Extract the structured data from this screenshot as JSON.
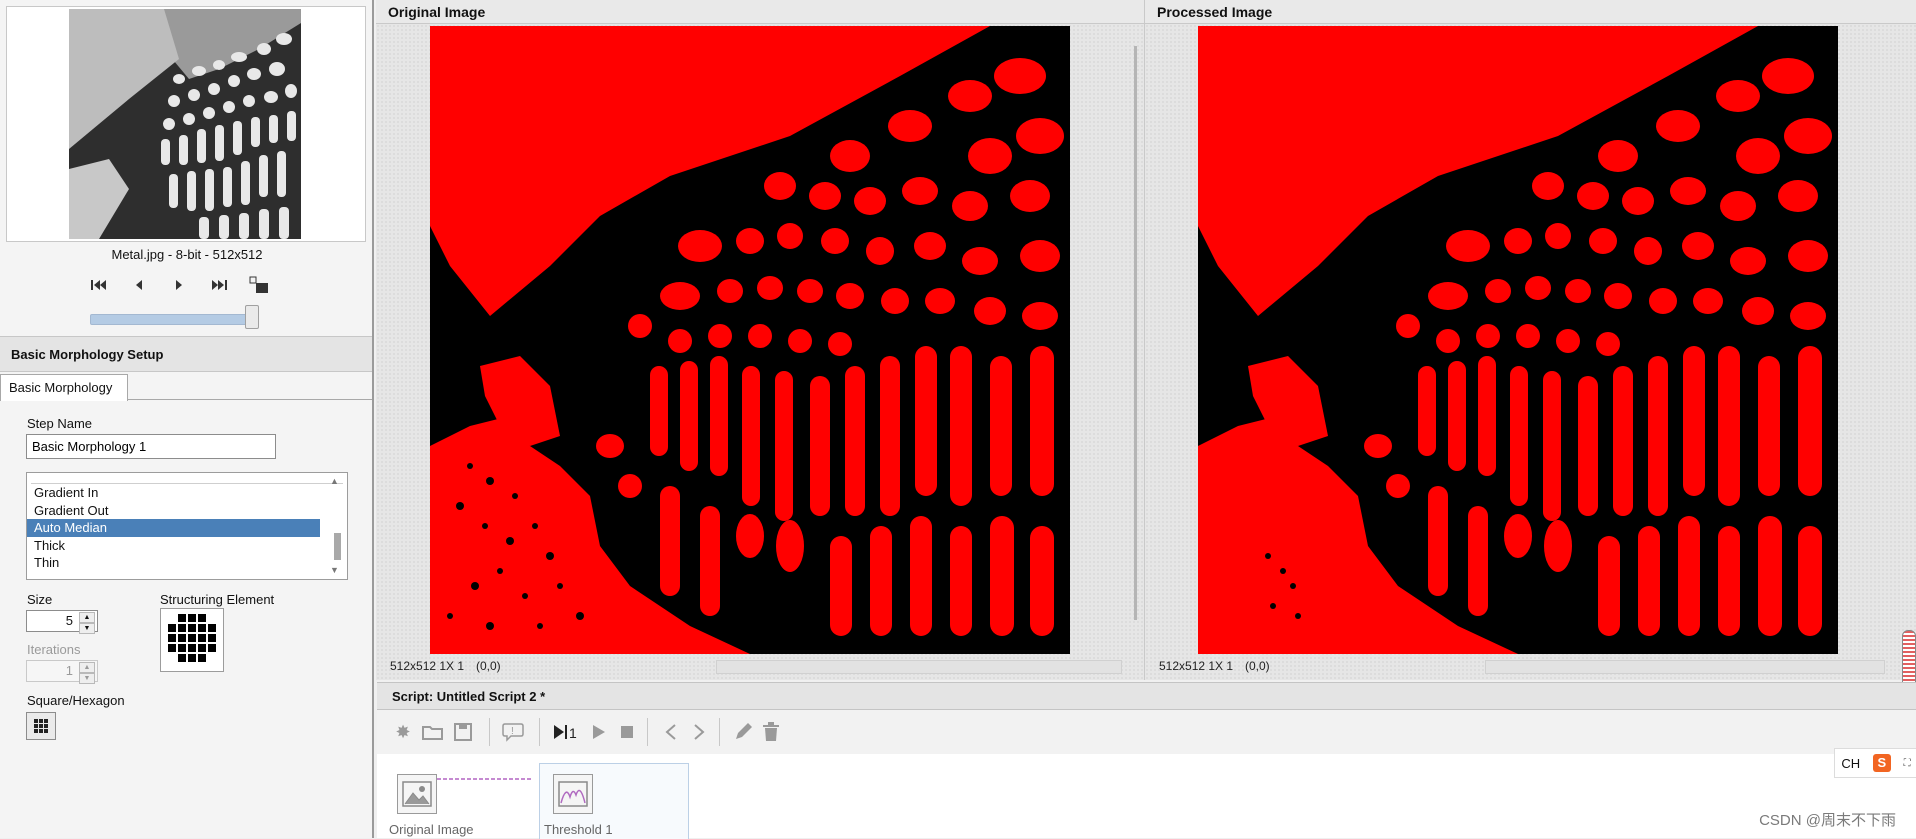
{
  "thumbnail": {
    "caption": "Metal.jpg - 8-bit - 512x512"
  },
  "setup": {
    "title": "Basic Morphology Setup",
    "tab_label": "Basic Morphology",
    "step_name_label": "Step Name",
    "step_name_value": "Basic Morphology 1",
    "operations": [
      "Gradient In",
      "Gradient Out",
      "Auto Median",
      "Thick",
      "Thin"
    ],
    "selected_operation": "Auto Median",
    "size_label": "Size",
    "size_value": "5",
    "iterations_label": "Iterations",
    "iterations_value": "1",
    "struct_label": "Structuring Element",
    "shape_label": "Square/Hexagon"
  },
  "original_view": {
    "title": "Original Image",
    "status_size": "512x512 1X 1",
    "status_coord": "(0,0)"
  },
  "processed_view": {
    "title": "Processed Image",
    "status_size": "512x512 1X 1",
    "status_coord": "(0,0)"
  },
  "script": {
    "title": "Script: Untitled Script 2 *",
    "steps": [
      "Original Image",
      "Threshold 1"
    ]
  },
  "toolbar_icons": [
    "new-icon",
    "open-folder-icon",
    "save-icon",
    "comment-icon",
    "run-step-icon",
    "run-icon",
    "stop-icon",
    "back-icon",
    "forward-icon",
    "edit-icon",
    "delete-icon"
  ],
  "ime": {
    "lang": "CH"
  },
  "watermark": "CSDN @周末不下雨",
  "colors": {
    "overlay_red": "#ff0000",
    "selection_blue": "#4a80b8"
  }
}
